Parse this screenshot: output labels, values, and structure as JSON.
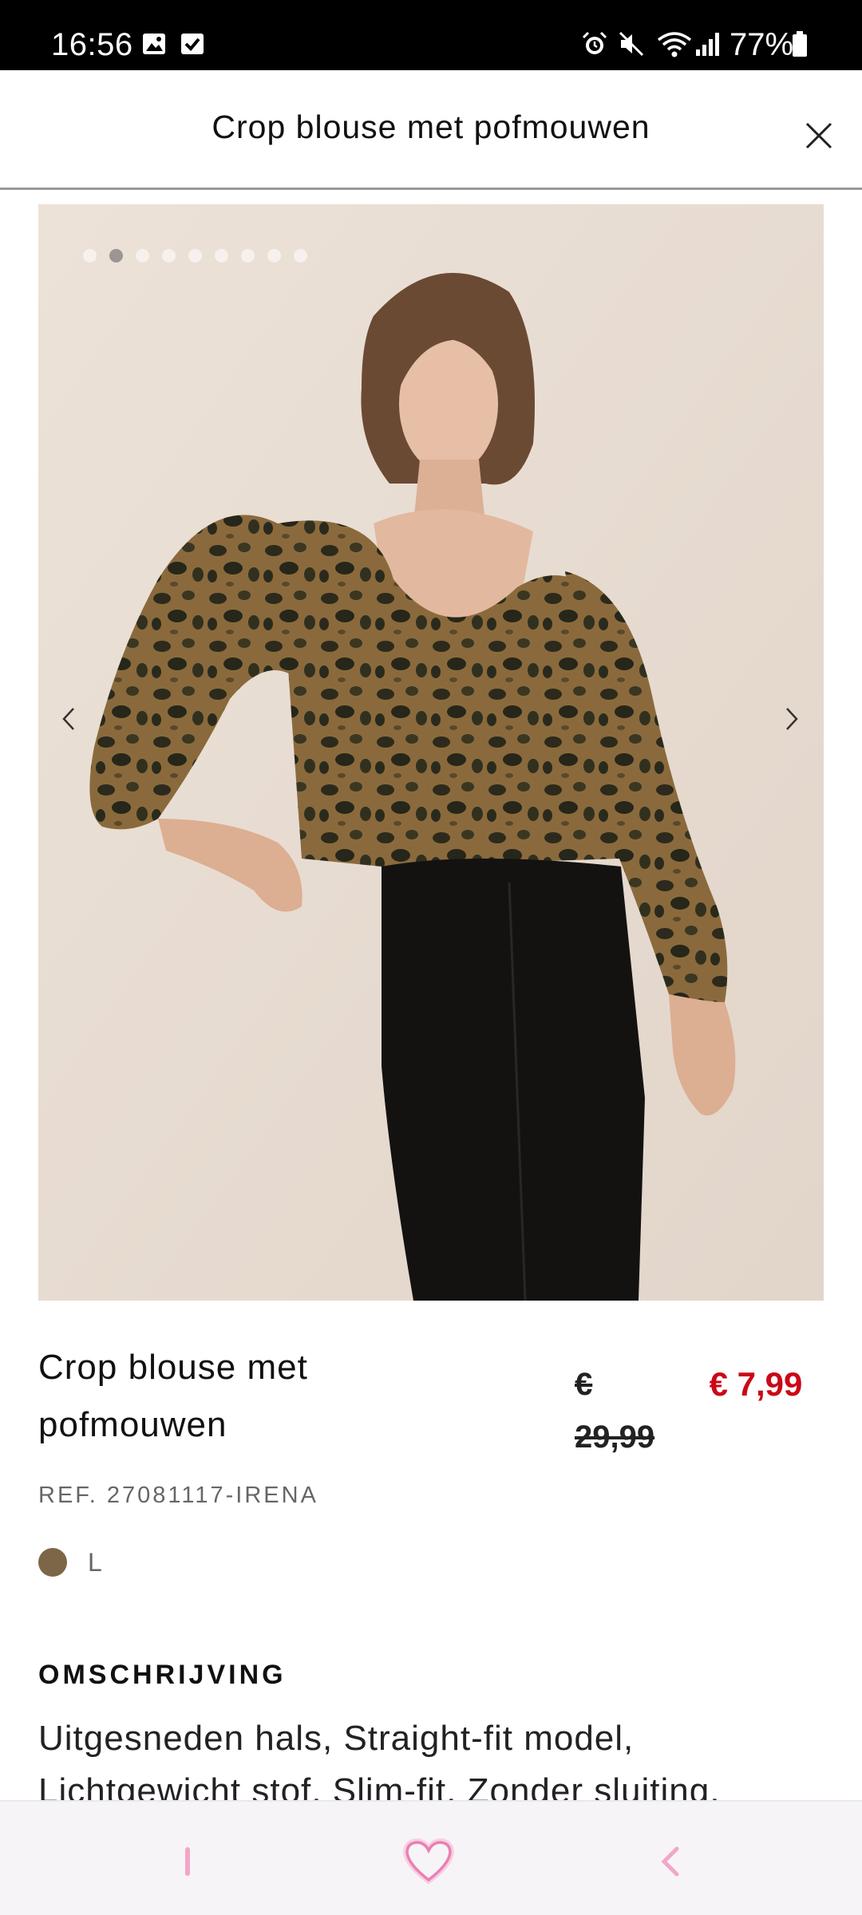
{
  "status_bar": {
    "time": "16:56",
    "battery": "77%",
    "icons": [
      "image-icon",
      "check-box-icon",
      "alarm-icon",
      "mute-icon",
      "wifi-icon",
      "signal-icon",
      "battery-icon"
    ]
  },
  "header": {
    "title": "Crop blouse met pofmouwen",
    "close_icon": "close-icon"
  },
  "gallery": {
    "image_count": 9,
    "active_index": 1,
    "prev_icon": "chevron-left-icon",
    "next_icon": "chevron-right-icon"
  },
  "product": {
    "name": "Crop blouse met pofmouwen",
    "old_price": "€ 29,99",
    "new_price": "€ 7,99",
    "ref": "REF. 27081117-IRENA",
    "size": "L",
    "colors": {
      "swatch": "#7d6648",
      "sale": "#c90a16"
    }
  },
  "description": {
    "title": "OMSCHRIJVING",
    "text": "Uitgesneden hals, Straight-fit model, Lichtgewicht stof, Slim-fit, Zonder sluiting,"
  },
  "bottom_nav": {
    "items": [
      "menu-icon",
      "heart-icon",
      "back-icon"
    ],
    "accent": "#f3a6c8"
  }
}
